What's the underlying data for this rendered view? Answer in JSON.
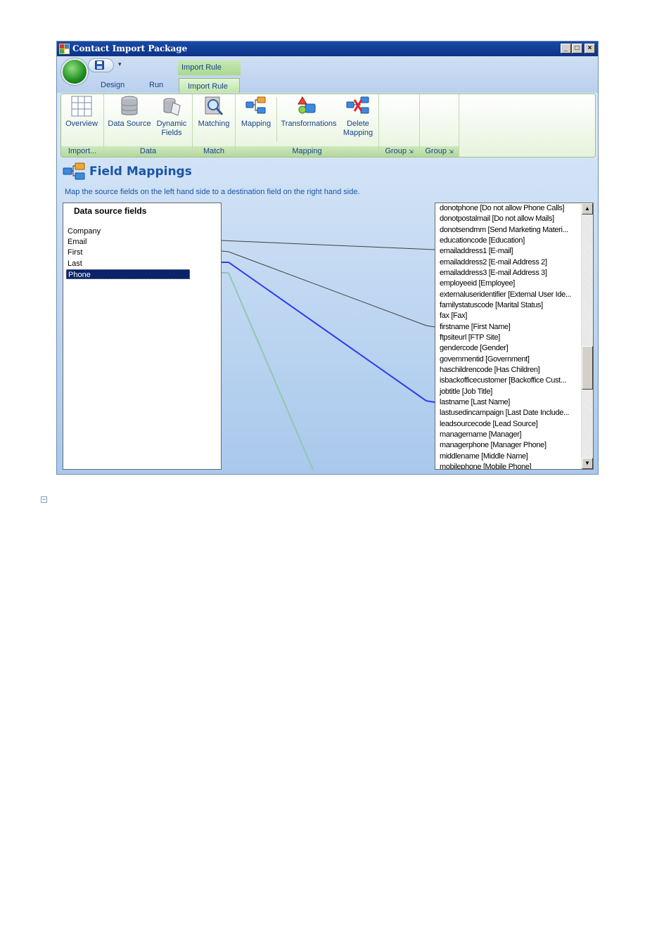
{
  "window": {
    "title": "Contact Import Package",
    "controls": {
      "minimize": "_",
      "maximize": "□",
      "close": "×"
    }
  },
  "ribbon": {
    "context_tab_header": "Import Rule",
    "tabs": [
      {
        "label": "Design"
      },
      {
        "label": "Run"
      },
      {
        "label": "Import Rule",
        "active": true
      }
    ],
    "groups": [
      {
        "label": "Import...",
        "buttons": [
          {
            "label": "Overview",
            "icon": "grid-icon"
          }
        ]
      },
      {
        "label": "Data",
        "buttons": [
          {
            "label": "Data Source",
            "icon": "database-icon"
          },
          {
            "label": "Dynamic Fields",
            "line1": "Dynamic",
            "line2": "Fields",
            "icon": "dynamic-fields-icon"
          }
        ]
      },
      {
        "label": "Match",
        "buttons": [
          {
            "label": "Matching",
            "icon": "magnifier-icon"
          }
        ]
      },
      {
        "label": "Mapping",
        "buttons": [
          {
            "label": "Mapping",
            "icon": "mapping-icon"
          },
          {
            "label": "Transformations",
            "icon": "transform-icon"
          },
          {
            "label": "Delete Mapping",
            "line1": "Delete",
            "line2": "Mapping",
            "icon": "delete-mapping-icon"
          }
        ]
      },
      {
        "label": "Group",
        "buttons": []
      },
      {
        "label": "Group",
        "buttons": []
      }
    ]
  },
  "content": {
    "title": "Field Mappings",
    "description": "Map the source fields on the left hand side to a destination field on the right hand side.",
    "source": {
      "header": "Data source fields",
      "fields": [
        "Company",
        "Email",
        "First",
        "Last",
        "Phone"
      ],
      "selected": "Phone"
    },
    "destination": {
      "fields": [
        "donotphone [Do not allow Phone Calls]",
        "donotpostalmail [Do not allow Mails]",
        "donotsendmm [Send Marketing Materi...",
        "educationcode [Education]",
        "emailaddress1 [E-mail]",
        "emailaddress2 [E-mail Address 2]",
        "emailaddress3 [E-mail Address 3]",
        "employeeid [Employee]",
        "externaluseridentifier [External User Ide...",
        "familystatuscode [Marital Status]",
        "fax [Fax]",
        "firstname [First Name]",
        "ftpsiteurl [FTP Site]",
        "gendercode [Gender]",
        "governmentid [Government]",
        "haschildrencode [Has Children]",
        "isbackofficecustomer [Backoffice Cust...",
        "jobtitle [Job Title]",
        "lastname [Last Name]",
        "lastusedincampaign [Last Date Include...",
        "leadsourcecode [Lead Source]",
        "managername [Manager]",
        "managerphone [Manager Phone]",
        "middlename [Middle Name]",
        "mobilephone [Mobile Phone]"
      ]
    },
    "mappings": [
      {
        "from": "Email",
        "to": "emailaddress1 [E-mail]",
        "color": "#404040"
      },
      {
        "from": "First",
        "to": "firstname [First Name]",
        "color": "#404040"
      },
      {
        "from": "Last",
        "to": "lastname [Last Name]",
        "color": "#2f3cf0"
      },
      {
        "from": "Phone",
        "to": "mobilephone [Mobile Phone]",
        "color": "#8fc9b0"
      }
    ]
  },
  "colors": {
    "accent": "#1b55a6",
    "selection": "#0a246a",
    "titlebar": "#0c3288"
  }
}
